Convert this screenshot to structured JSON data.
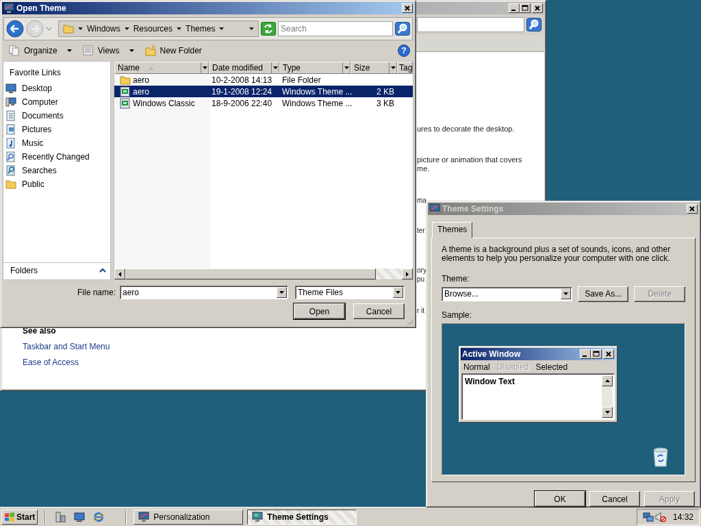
{
  "background_window": {
    "active": false,
    "text_fragments": [
      "ures to decorate the desktop.",
      "picture or animation that covers",
      "me.",
      "ma",
      "ter",
      "ory",
      "pu",
      "r it"
    ],
    "see_also": {
      "heading": "See also",
      "links": [
        "Taskbar and Start Menu",
        "Ease of Access"
      ]
    }
  },
  "open_dialog": {
    "title": "Open Theme",
    "active": true,
    "breadcrumb": [
      "Windows",
      "Resources",
      "Themes"
    ],
    "search": {
      "placeholder": "Search"
    },
    "toolbar": [
      {
        "label": "Organize",
        "kind": "organize"
      },
      {
        "label": "Views",
        "kind": "views"
      },
      {
        "label": "New Folder",
        "kind": "new_folder"
      }
    ],
    "help": "?",
    "favorite_links": {
      "heading": "Favorite Links",
      "items": [
        {
          "label": "Desktop",
          "kind": "desktop"
        },
        {
          "label": "Computer",
          "kind": "computer"
        },
        {
          "label": "Documents",
          "kind": "documents"
        },
        {
          "label": "Pictures",
          "kind": "pictures"
        },
        {
          "label": "Music",
          "kind": "music"
        },
        {
          "label": "Recently Changed",
          "kind": "recent"
        },
        {
          "label": "Searches",
          "kind": "searches"
        },
        {
          "label": "Public",
          "kind": "public"
        }
      ]
    },
    "folders_label": "Folders",
    "columns": [
      {
        "label": "Name",
        "sorted": true
      },
      {
        "label": "Date modified",
        "sorted": false
      },
      {
        "label": "Type",
        "sorted": false
      },
      {
        "label": "Size",
        "sorted": false
      },
      {
        "label": "Tag",
        "sorted": false
      }
    ],
    "rows": [
      {
        "name": "aero",
        "date": "10-2-2008 14:13",
        "type": "File Folder",
        "size": "",
        "kind": "folder",
        "selected": false
      },
      {
        "name": "aero",
        "date": "19-1-2008 12:24",
        "type": "Windows Theme ...",
        "size": "2 KB",
        "kind": "theme",
        "selected": true
      },
      {
        "name": "Windows Classic",
        "date": "18-9-2006 22:40",
        "type": "Windows Theme ...",
        "size": "3 KB",
        "kind": "theme",
        "selected": false
      }
    ],
    "file_name_label": "File name:",
    "file_name": "aero",
    "file_type": "Theme Files",
    "buttons": [
      {
        "label": "Open",
        "default": true
      },
      {
        "label": "Cancel",
        "default": false
      }
    ]
  },
  "theme_settings": {
    "title": "Theme Settings",
    "active": false,
    "tabs": [
      {
        "label": "Themes",
        "selected": true
      }
    ],
    "description": "A theme is a background plus a set of sounds, icons, and other elements to help you personalize your computer with one click.",
    "theme_label": "Theme:",
    "theme_value": "Browse...",
    "buttons": [
      {
        "label": "Save As...",
        "disabled": false
      },
      {
        "label": "Delete",
        "disabled": true
      }
    ],
    "sample_label": "Sample:",
    "sample": {
      "title": "Active Window",
      "menu": [
        {
          "label": "Normal",
          "disabled": false
        },
        {
          "label": "Disabled",
          "disabled": true
        },
        {
          "label": "Selected",
          "disabled": false
        }
      ],
      "text": "Window Text"
    },
    "footer_buttons": [
      {
        "label": "OK",
        "default": true,
        "disabled": false
      },
      {
        "label": "Cancel",
        "default": false,
        "disabled": false
      },
      {
        "label": "Apply",
        "default": false,
        "disabled": true
      }
    ]
  },
  "taskbar": {
    "start": "Start",
    "tasks": [
      {
        "label": "Personalization",
        "selected": false,
        "kind": "personalization"
      },
      {
        "label": "Theme Settings",
        "selected": true,
        "kind": "theme"
      }
    ],
    "clock": "14:32"
  }
}
